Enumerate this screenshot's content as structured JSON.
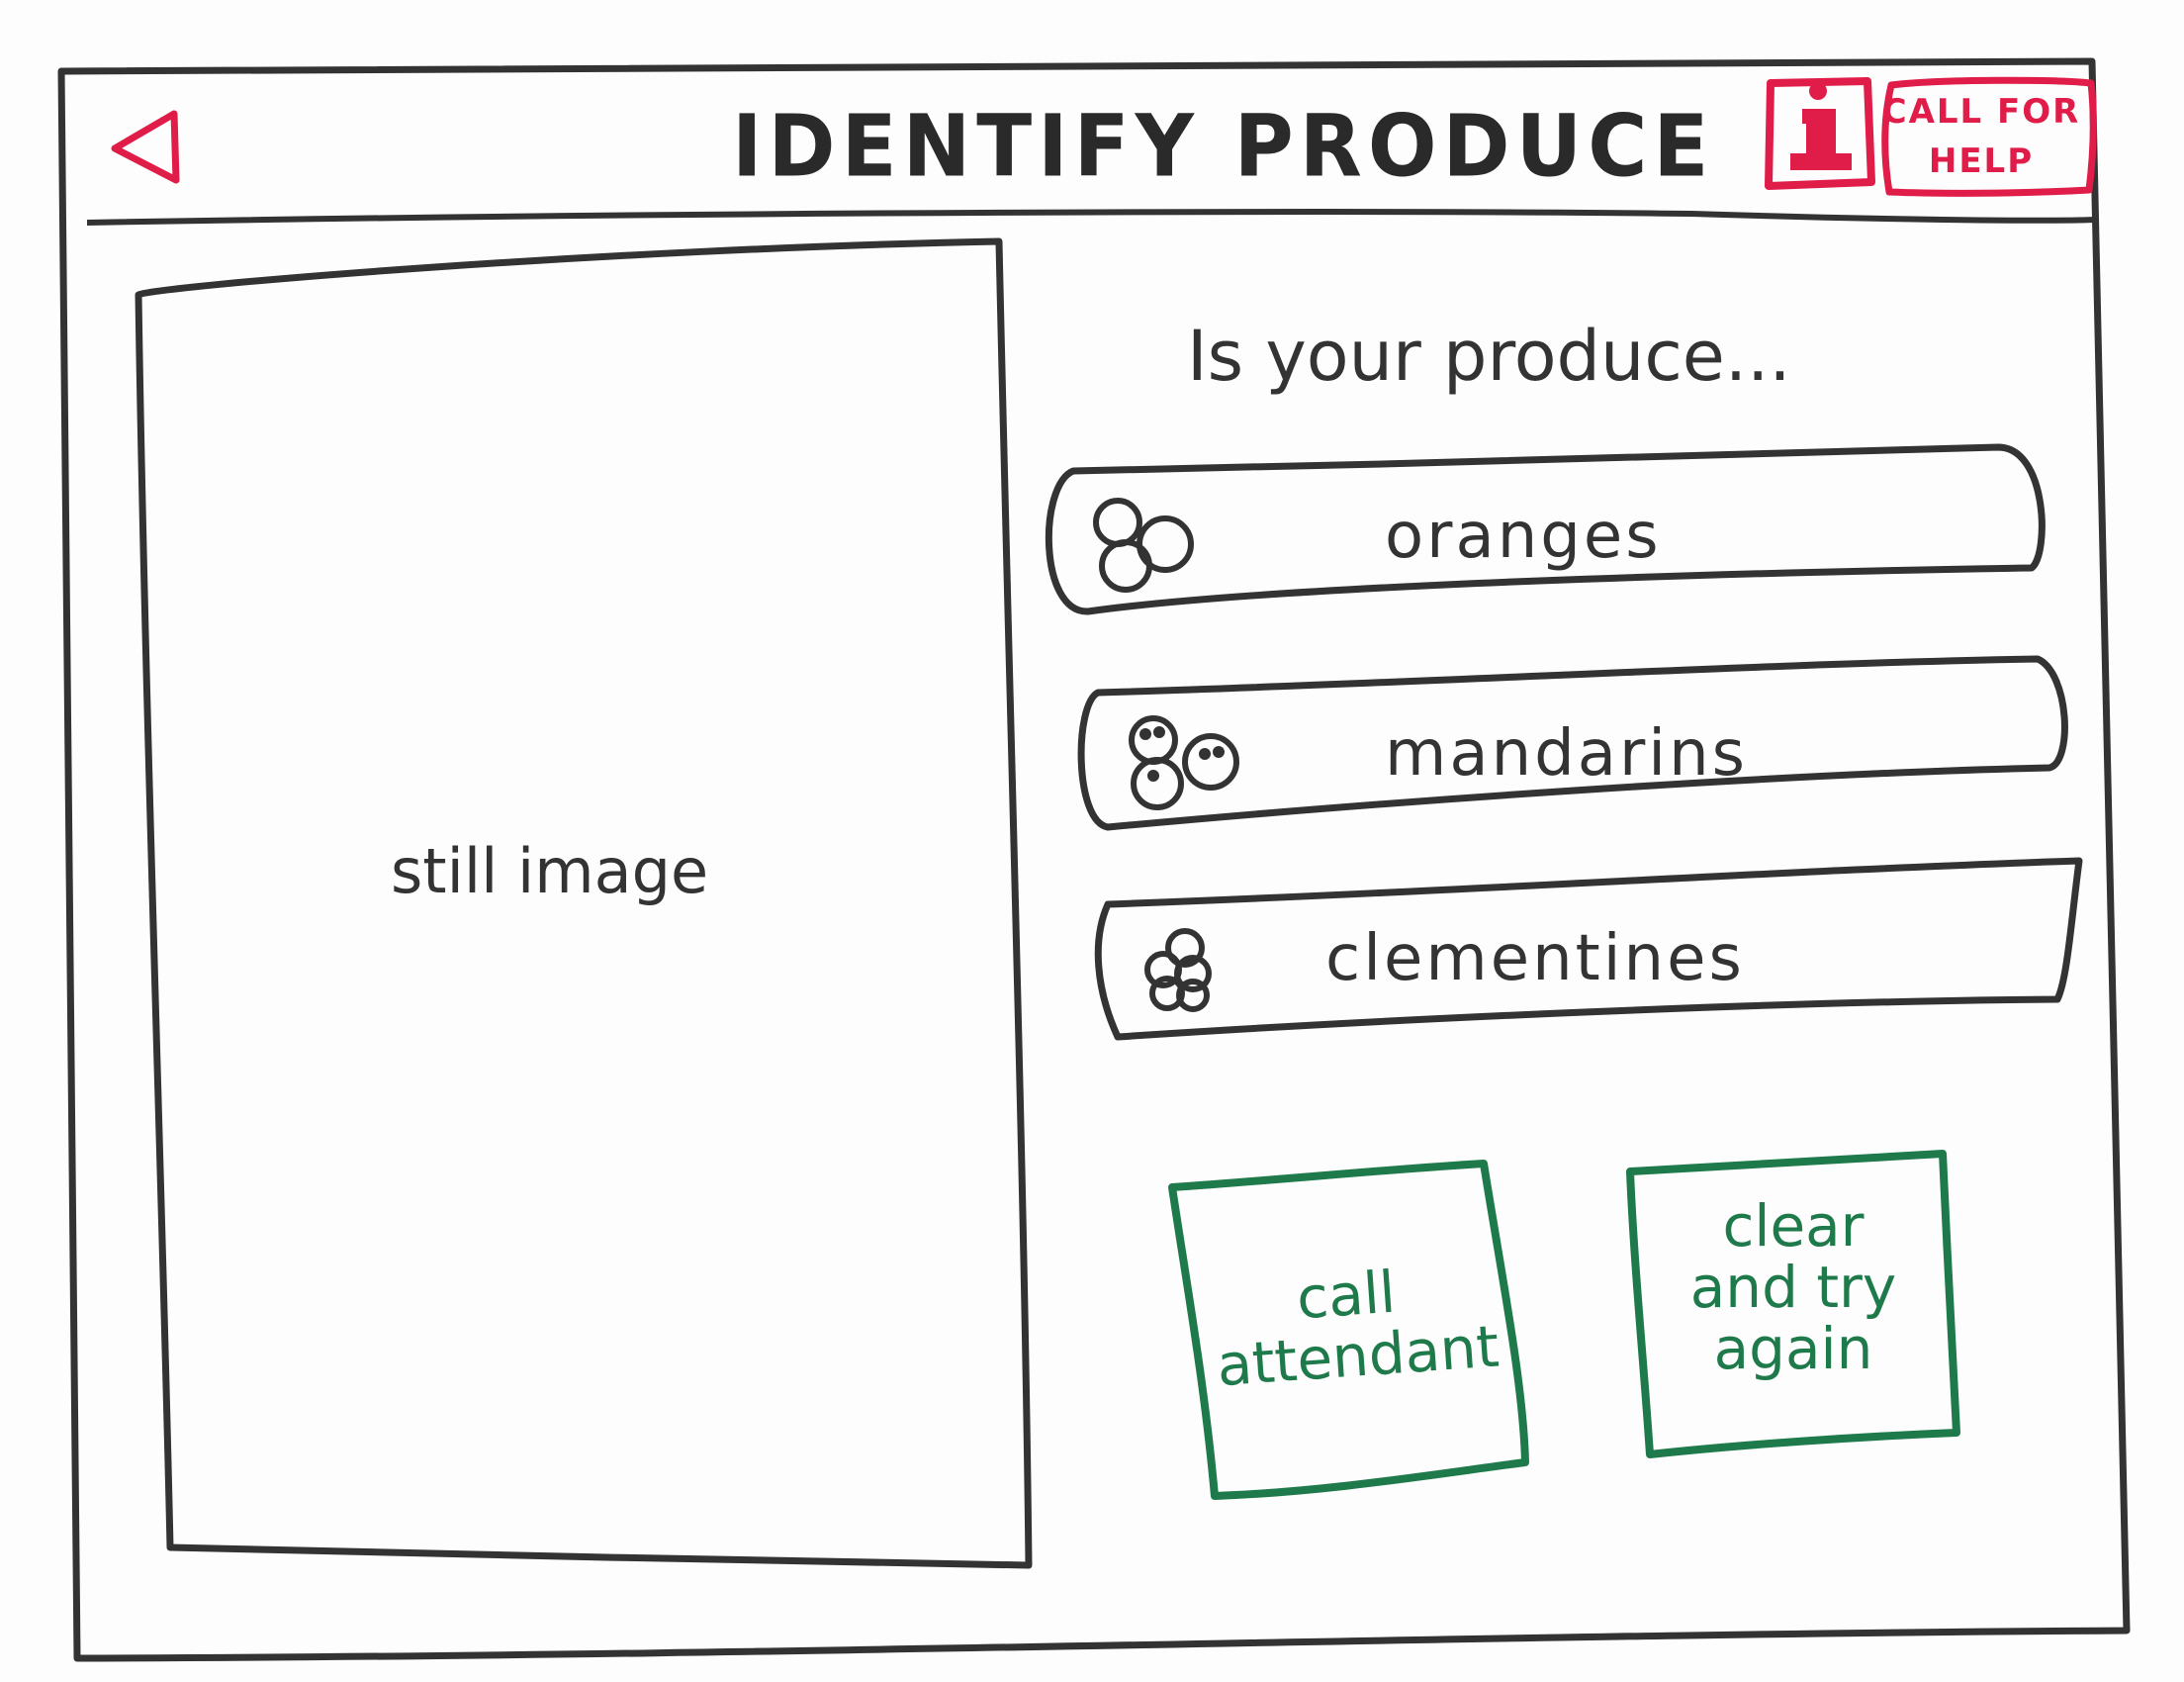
{
  "header": {
    "back_icon": "back-triangle-icon",
    "title": "IDENTIFY PRODUCE",
    "info_icon": "info-icon",
    "help_button_label": "CALL FOR HELP"
  },
  "preview": {
    "label": "still image"
  },
  "question": {
    "prompt": "Is your produce..."
  },
  "options": [
    {
      "label": "oranges",
      "icon": "oranges-icon"
    },
    {
      "label": "mandarins",
      "icon": "mandarins-icon"
    },
    {
      "label": "clementines",
      "icon": "clementines-icon"
    }
  ],
  "actions": {
    "call_attendant": "call attendant",
    "clear_and_try_again": "clear and try again"
  },
  "colors": {
    "ink": "#2b2b2b",
    "accent_red": "#e01c48",
    "action_green": "#1e7a4a"
  }
}
